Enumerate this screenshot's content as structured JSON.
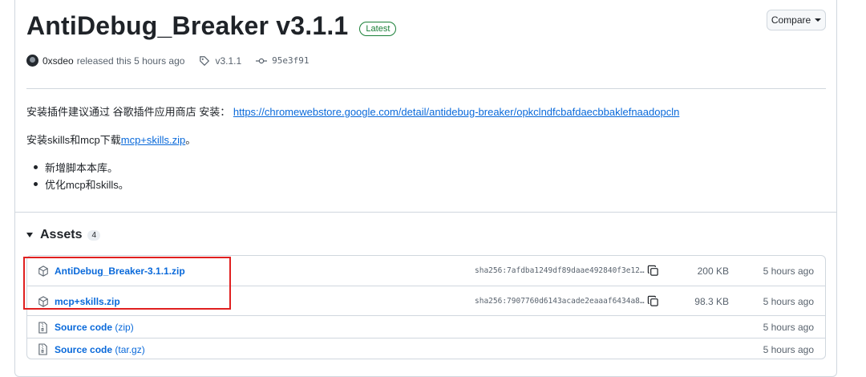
{
  "release": {
    "title": "AntiDebug_Breaker v3.1.1",
    "badge": "Latest",
    "compare_label": "Compare"
  },
  "meta": {
    "user": "0xsdeo",
    "released_text": "released this 5 hours ago",
    "tag": "v3.1.1",
    "commit": "95e3f91"
  },
  "notes": {
    "line1_prefix": "安装插件建议通过 谷歌插件应用商店 安装：",
    "line1_link": "https://chromewebstore.google.com/detail/antidebug-breaker/opkclndfcbafdaecbbaklefnaadopcln",
    "line2_prefix": "安装skills和mcp下载",
    "line2_link": "mcp+skills.zip",
    "line2_suffix": "。",
    "bullets": [
      "新增脚本本库。",
      "优化mcp和skills。"
    ]
  },
  "assets": {
    "title": "Assets",
    "count": "4",
    "rows": [
      {
        "icon": "package-icon",
        "name": "AntiDebug_Breaker-3.1.1.zip",
        "ext": "",
        "sha": "sha256:7afdba1249df89daae492840f3e12…",
        "size": "200 KB",
        "time": "5 hours ago"
      },
      {
        "icon": "package-icon",
        "name": "mcp+skills.zip",
        "ext": "",
        "sha": "sha256:7907760d6143acade2eaaaf6434a8…",
        "size": "98.3 KB",
        "time": "5 hours ago"
      },
      {
        "icon": "file-zip-icon",
        "name": "Source code",
        "ext": " (zip)",
        "sha": "",
        "size": "",
        "time": "5 hours ago"
      },
      {
        "icon": "file-zip-icon",
        "name": "Source code",
        "ext": " (tar.gz)",
        "sha": "",
        "size": "",
        "time": "5 hours ago"
      }
    ]
  },
  "colors": {
    "link": "#0969da",
    "badge_green": "#1a7f37",
    "highlight_red": "#e02020",
    "border": "#d0d7de"
  }
}
